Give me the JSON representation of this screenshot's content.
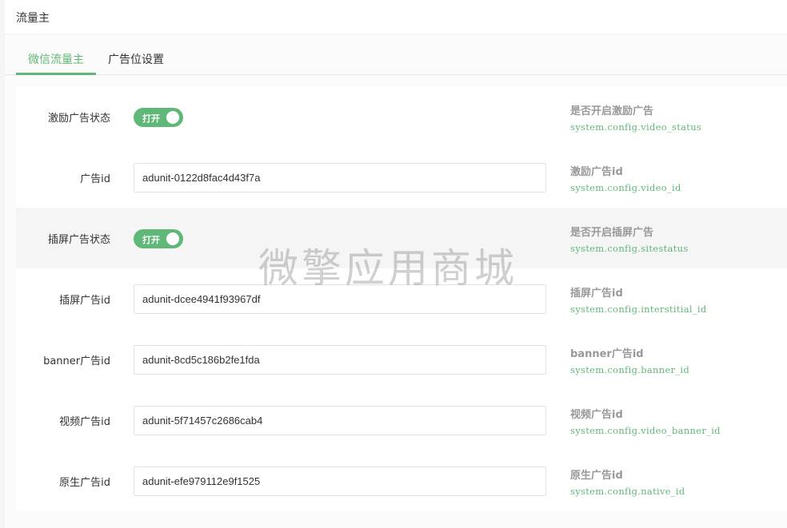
{
  "header": {
    "title": "流量主"
  },
  "tabs": [
    {
      "label": "微信流量主",
      "active": true
    },
    {
      "label": "广告位设置",
      "active": false
    }
  ],
  "theme": {
    "accent": "#5fb878"
  },
  "rows": [
    {
      "label": "激励广告状态",
      "type": "switch",
      "switch_text": "打开",
      "on": true,
      "help_title": "是否开启激励广告",
      "help_code": "system.config.video_status"
    },
    {
      "label": "广告id",
      "type": "input",
      "value": "adunit-0122d8fac4d43f7a",
      "help_title": "激励广告id",
      "help_code": "system.config.video_id"
    },
    {
      "label": "插屏广告状态",
      "type": "switch",
      "switch_text": "打开",
      "on": true,
      "help_title": "是否开启插屏广告",
      "help_code": "system.config.sitestatus"
    },
    {
      "label": "插屏广告id",
      "type": "input",
      "value": "adunit-dcee4941f93967df",
      "help_title": "插屏广告id",
      "help_code": "system.config.interstitial_id"
    },
    {
      "label": "banner广告id",
      "type": "input",
      "value": "adunit-8cd5c186b2fe1fda",
      "help_title": "banner广告id",
      "help_code": "system.config.banner_id"
    },
    {
      "label": "视频广告id",
      "type": "input",
      "value": "adunit-5f71457c2686cab4",
      "help_title": "视频广告id",
      "help_code": "system.config.video_banner_id"
    },
    {
      "label": "原生广告id",
      "type": "input",
      "value": "adunit-efe979112e9f1525",
      "help_title": "原生广告id",
      "help_code": "system.config.native_id"
    }
  ],
  "watermark": "微擎应用商城"
}
